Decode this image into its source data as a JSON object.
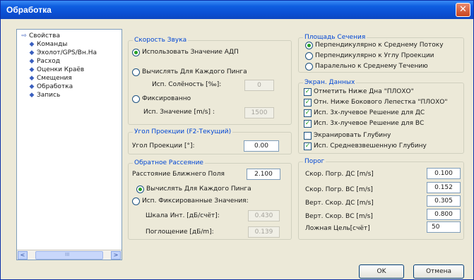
{
  "window": {
    "title": "Обработка",
    "close_glyph": "✕"
  },
  "tree": {
    "items": [
      {
        "label": "Свойства",
        "icon": "arrow-right-icon"
      },
      {
        "label": "Команды",
        "icon": "diamond-icon"
      },
      {
        "label": "Эхолот/GPS/Вн.На",
        "icon": "diamond-icon"
      },
      {
        "label": "Расход",
        "icon": "diamond-icon"
      },
      {
        "label": "Оценки Краёв",
        "icon": "diamond-icon"
      },
      {
        "label": "Смещения",
        "icon": "diamond-icon"
      },
      {
        "label": "Обработка",
        "icon": "diamond-icon"
      },
      {
        "label": "Запись",
        "icon": "diamond-icon"
      }
    ],
    "scroll_left": "<",
    "scroll_right": ">",
    "scroll_thumb_grip": "III"
  },
  "sound_speed": {
    "title": "Скорость Звука",
    "use_adcp": "Использовать Значение АДП",
    "compute_each_ping": "Вычислять Для Каждого Пинга",
    "salinity_label": "Исп. Солёность [‰]:",
    "salinity_value": "0",
    "fixed": "Фиксированно",
    "value_label": "Исп. Значение [m/s] :",
    "value": "1500"
  },
  "heading": {
    "title": "Угол Проекции (F2-Текущий)",
    "label": "Угол Проекции [°]:",
    "value": "0.00"
  },
  "backscatter": {
    "title": "Обратное Рассеяние",
    "near_field_label": "Расстояние Ближнего Поля",
    "near_field_value": "2.100",
    "compute_each_ping": "Вычислять Для Каждого Пинга",
    "use_fixed": "Исп. Фиксированные Значения:",
    "scale_label": "Шкала Инт. [дБ/счёт]:",
    "scale_value": "0.430",
    "absorption_label": "Поглощение [дБ/m]:",
    "absorption_value": "0.139"
  },
  "cross_section": {
    "title": "Площадь Сечения",
    "opt1": "Перпендикулярно к Среднему Потоку",
    "opt2": "Перпендикулярно к Углу Проекции",
    "opt3": "Паралельно к Среднему Течению"
  },
  "screening": {
    "title": "Экран. Данных",
    "items": [
      {
        "label": "Отметить Ниже Дна \"ПЛОХО\"",
        "checked": true
      },
      {
        "label": "Отн. Ниже Бокового Лепестка \"ПЛОХО\"",
        "checked": true
      },
      {
        "label": "Исп. 3х-лучевое Решение для ДС",
        "checked": true
      },
      {
        "label": "Исп. 3х-лучевое Решение для ВС",
        "checked": true
      },
      {
        "label": "Экранировать Глубину",
        "checked": false
      },
      {
        "label": "Исп. Средневзвешенную Глубину",
        "checked": true
      }
    ]
  },
  "threshold": {
    "title": "Порог",
    "rows": [
      {
        "label": "Скор. Погр. ДС [m/s]",
        "value": "0.100"
      },
      {
        "label": "Скор. Погр. ВС [m/s]",
        "value": "0.152"
      },
      {
        "label": "Верт. Скор. ДС [m/s]",
        "value": "0.305"
      },
      {
        "label": "Верт. Скор. ВС [m/s]",
        "value": "0.800"
      },
      {
        "label": "Ложная Цель[счёт]",
        "value": "50"
      }
    ]
  },
  "buttons": {
    "ok": "OK",
    "cancel": "Отмена"
  },
  "colors": {
    "title_bar": "#0a4fd3",
    "group_title": "#0046d5",
    "radio_dot": "#26a026",
    "check_mark": "#21a121"
  }
}
